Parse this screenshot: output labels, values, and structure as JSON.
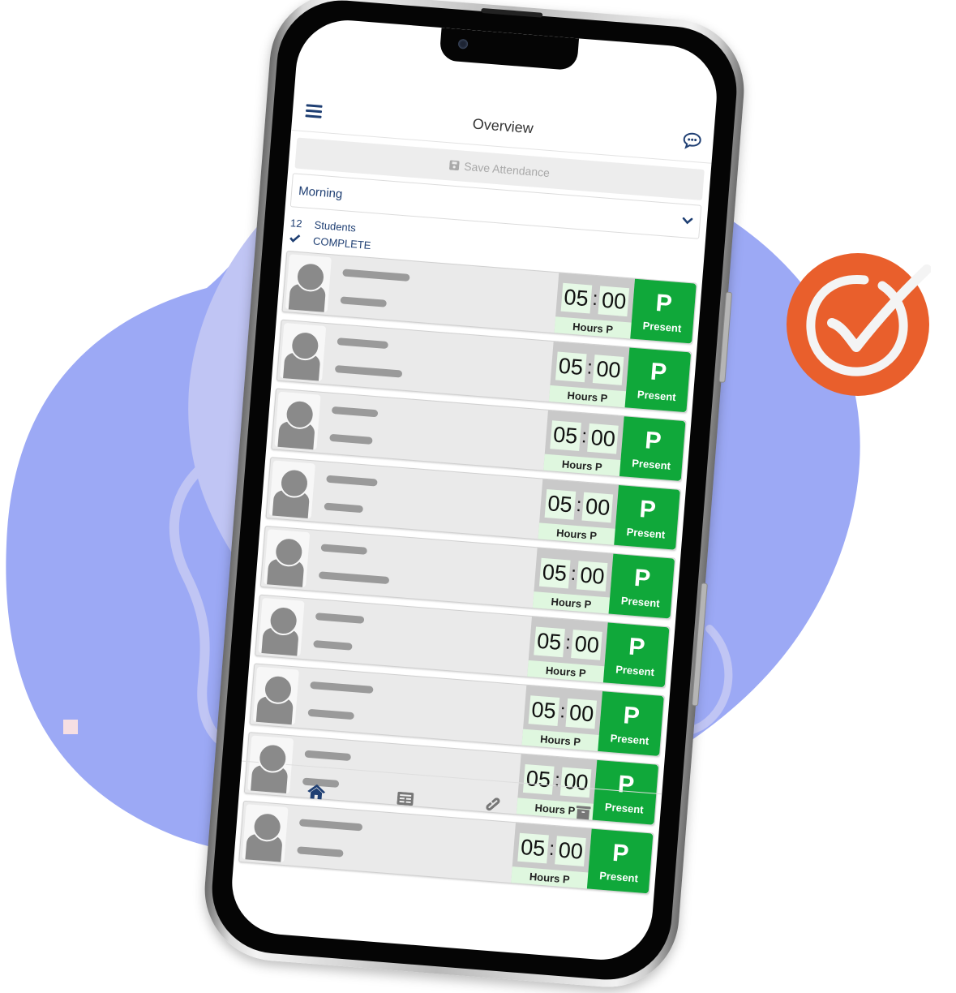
{
  "colors": {
    "blob_main": "#9ca9f5",
    "blob_light": "#c0c5f4",
    "badge_orange": "#e95f2c",
    "brand_navy": "#1f3f73",
    "present_green": "#10a83a",
    "hours_bg": "#dff7df"
  },
  "header": {
    "title": "Overview",
    "menu_icon": "hamburger-menu-icon",
    "chat_icon": "chat-bubble-icon"
  },
  "toolbar": {
    "save_label": "Save Attendance",
    "save_icon": "floppy-disk-icon"
  },
  "session_select": {
    "value": "Morning",
    "icon": "chevron-down-icon"
  },
  "summary": {
    "count": "12",
    "count_label": "Students",
    "status": "COMPLETE",
    "status_icon": "checkmark-icon"
  },
  "students": [
    {
      "hours": "05",
      "minutes": "00",
      "hours_label": "Hours P",
      "status_code": "P",
      "status_label": "Present",
      "line1": 0.55,
      "line2": 0.38
    },
    {
      "hours": "05",
      "minutes": "00",
      "hours_label": "Hours P",
      "status_code": "P",
      "status_label": "Present",
      "line1": 0.42,
      "line2": 0.55
    },
    {
      "hours": "05",
      "minutes": "00",
      "hours_label": "Hours P",
      "status_code": "P",
      "status_label": "Present",
      "line1": 0.38,
      "line2": 0.35
    },
    {
      "hours": "05",
      "minutes": "00",
      "hours_label": "Hours P",
      "status_code": "P",
      "status_label": "Present",
      "line1": 0.42,
      "line2": 0.32
    },
    {
      "hours": "05",
      "minutes": "00",
      "hours_label": "Hours P",
      "status_code": "P",
      "status_label": "Present",
      "line1": 0.38,
      "line2": 0.58
    },
    {
      "hours": "05",
      "minutes": "00",
      "hours_label": "Hours P",
      "status_code": "P",
      "status_label": "Present",
      "line1": 0.4,
      "line2": 0.32
    },
    {
      "hours": "05",
      "minutes": "00",
      "hours_label": "Hours P",
      "status_code": "P",
      "status_label": "Present",
      "line1": 0.52,
      "line2": 0.38
    },
    {
      "hours": "05",
      "minutes": "00",
      "hours_label": "Hours P",
      "status_code": "P",
      "status_label": "Present",
      "line1": 0.38,
      "line2": 0.3
    },
    {
      "hours": "05",
      "minutes": "00",
      "hours_label": "Hours P",
      "status_code": "P",
      "status_label": "Present",
      "line1": 0.52,
      "line2": 0.38
    }
  ],
  "tabbar": {
    "items": [
      {
        "icon": "home-icon",
        "active": true
      },
      {
        "icon": "list-card-icon",
        "active": false
      },
      {
        "icon": "link-icon",
        "active": false
      },
      {
        "icon": "archive-box-icon",
        "active": false
      }
    ]
  },
  "decor": {
    "badge_icon": "check-circle-icon"
  }
}
